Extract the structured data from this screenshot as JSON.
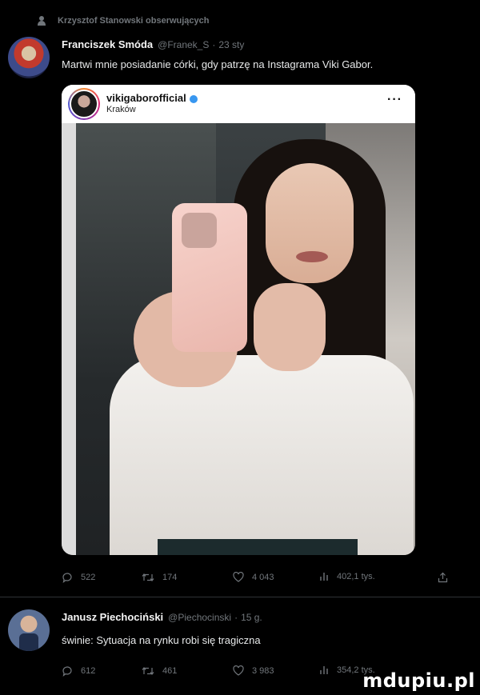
{
  "social_context": {
    "text": "Krzysztof Stanowski obserwujących",
    "icon": "person-icon"
  },
  "tweets": [
    {
      "author_name": "Franciszek Smóda",
      "handle": "@Franek_S",
      "separator": "·",
      "time": "23 sty",
      "text": "Martwi mnie posiadanie córki, gdy patrzę na Instagrama Viki Gabor.",
      "embed": {
        "username": "vikigaborofficial",
        "verified": true,
        "location": "Kraków",
        "more_label": "···"
      },
      "actions": {
        "replies": "522",
        "retweets": "174",
        "likes": "4 043",
        "views": "402,1 tys."
      }
    },
    {
      "author_name": "Janusz Piechociński",
      "handle": "@Piechocinski",
      "separator": "·",
      "time": "15 g.",
      "text": "świnie: Sytuacja na rynku robi się tragiczna",
      "actions": {
        "replies": "612",
        "retweets": "461",
        "likes": "3 983",
        "views": "354,2 tys."
      }
    }
  ],
  "watermark": "mdupiu.pl",
  "colors": {
    "background": "#000000",
    "text": "#e7e9ea",
    "muted": "#71767b",
    "verified": "#3897f0"
  }
}
